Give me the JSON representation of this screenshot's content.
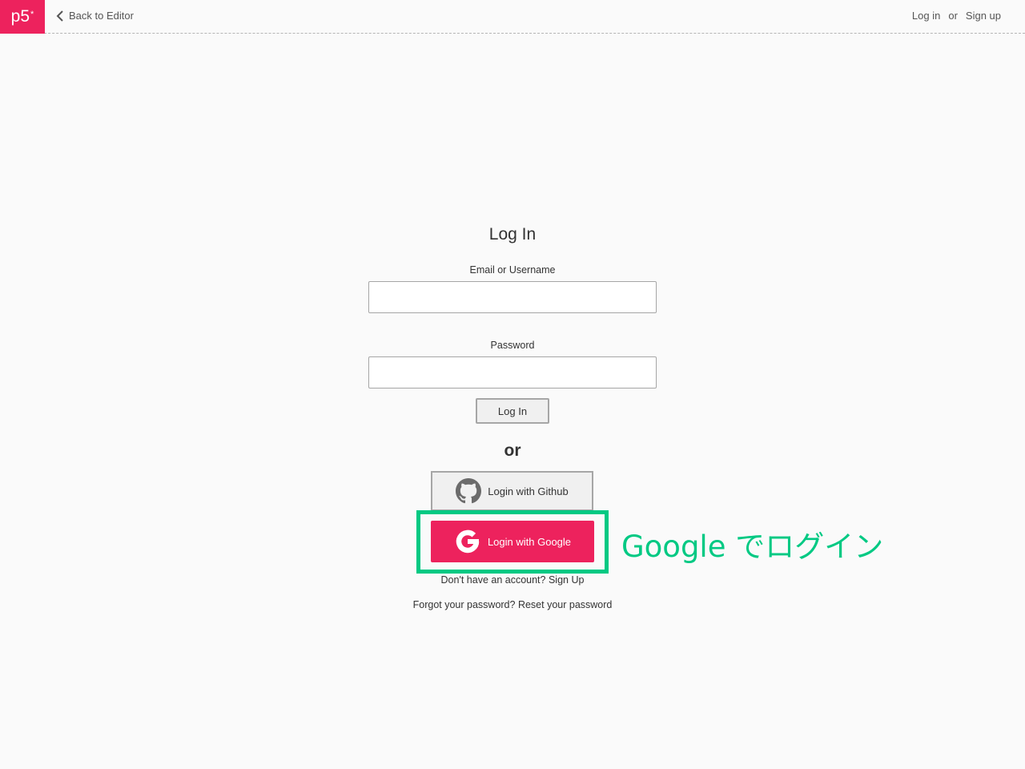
{
  "nav": {
    "logo_text": "p5",
    "logo_sup": "*",
    "back_label": "Back to Editor",
    "login_label": "Log in",
    "or_label": "or",
    "signup_label": "Sign up"
  },
  "form": {
    "title": "Log In",
    "email_label": "Email or Username",
    "email_value": "",
    "password_label": "Password",
    "password_value": "",
    "submit_label": "Log In",
    "or_divider": "or",
    "github_label": "Login with Github",
    "google_label": "Login with Google",
    "signup_prompt": "Don't have an account?",
    "signup_link": "Sign Up",
    "reset_prompt": "Forgot your password?",
    "reset_link": "Reset your password"
  },
  "annotation": {
    "text": "Google でログイン",
    "color": "#00c983"
  },
  "colors": {
    "brand": "#ed225d",
    "highlight": "#00c983",
    "background": "#fafafa"
  },
  "icons": {
    "back": "chevron-left-icon",
    "github": "github-icon",
    "google": "google-icon"
  }
}
